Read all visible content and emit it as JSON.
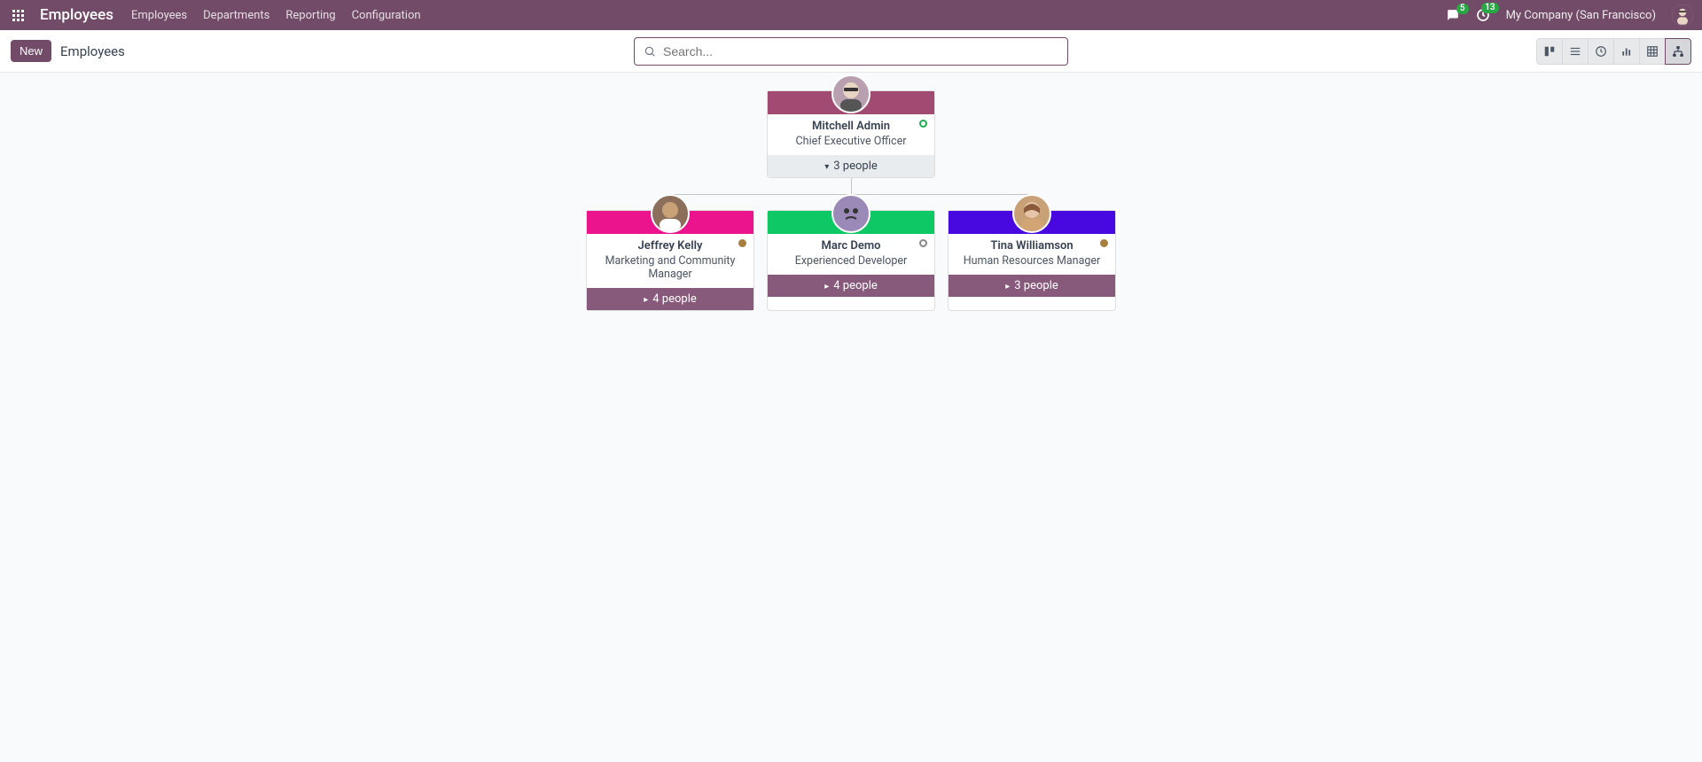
{
  "navbar": {
    "brand": "Employees",
    "menu": [
      {
        "label": "Employees"
      },
      {
        "label": "Departments"
      },
      {
        "label": "Reporting"
      },
      {
        "label": "Configuration"
      }
    ],
    "chat_badge": "5",
    "activity_badge": "13",
    "company": "My Company (San Francisco)"
  },
  "control_panel": {
    "new_btn": "New",
    "breadcrumb": "Employees",
    "search_placeholder": "Search..."
  },
  "chart": {
    "root": {
      "name": "Mitchell Admin",
      "title": "Chief Executive Officer",
      "people_label": "3 people",
      "header_color": "#A24B72",
      "status": "online",
      "expanded": true,
      "avatar_bg": "#b8a0b0"
    },
    "children": [
      {
        "name": "Jeffrey Kelly",
        "title": "Marketing and Community Manager",
        "people_label": "4 people",
        "header_color": "#EB148C",
        "status": "away",
        "avatar_bg": "#8b6f5a"
      },
      {
        "name": "Marc Demo",
        "title": "Experienced Developer",
        "people_label": "4 people",
        "header_color": "#0EC765",
        "status": "offline",
        "avatar_bg": "#9b8ab8"
      },
      {
        "name": "Tina Williamson",
        "title": "Human Resources Manager",
        "people_label": "3 people",
        "header_color": "#4808E0",
        "status": "away",
        "avatar_bg": "#c9a176"
      }
    ]
  }
}
